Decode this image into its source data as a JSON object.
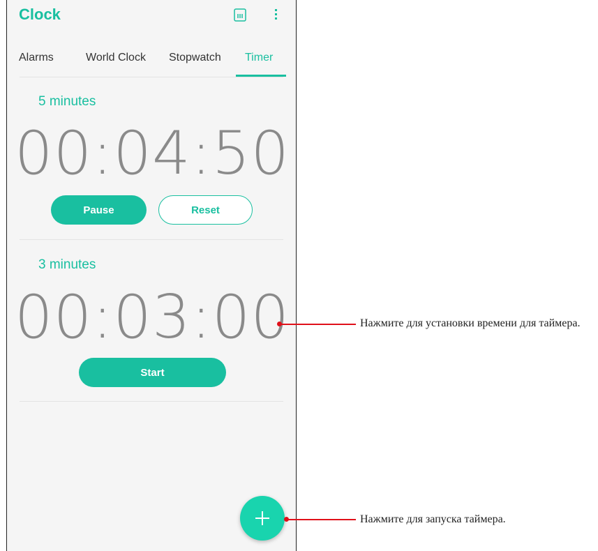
{
  "app": {
    "title": "Clock"
  },
  "tabs": [
    {
      "label": "Alarms",
      "active": false
    },
    {
      "label": "World Clock",
      "active": false
    },
    {
      "label": "Stopwatch",
      "active": false
    },
    {
      "label": "Timer",
      "active": true
    }
  ],
  "timers": [
    {
      "label": "5 minutes",
      "time": "00:04:50",
      "buttons": [
        "Pause",
        "Reset"
      ]
    },
    {
      "label": "3 minutes",
      "time": "00:03:00",
      "buttons": [
        "Start"
      ]
    }
  ],
  "fab": {
    "icon": "plus-icon"
  },
  "callouts": [
    {
      "text": "Нажмите для установки времени для таймера."
    },
    {
      "text": "Нажмите для запуска таймера."
    }
  ],
  "colors": {
    "accent": "#19bfa0",
    "fab": "#19d4ae",
    "callout_line": "#e0101a"
  }
}
